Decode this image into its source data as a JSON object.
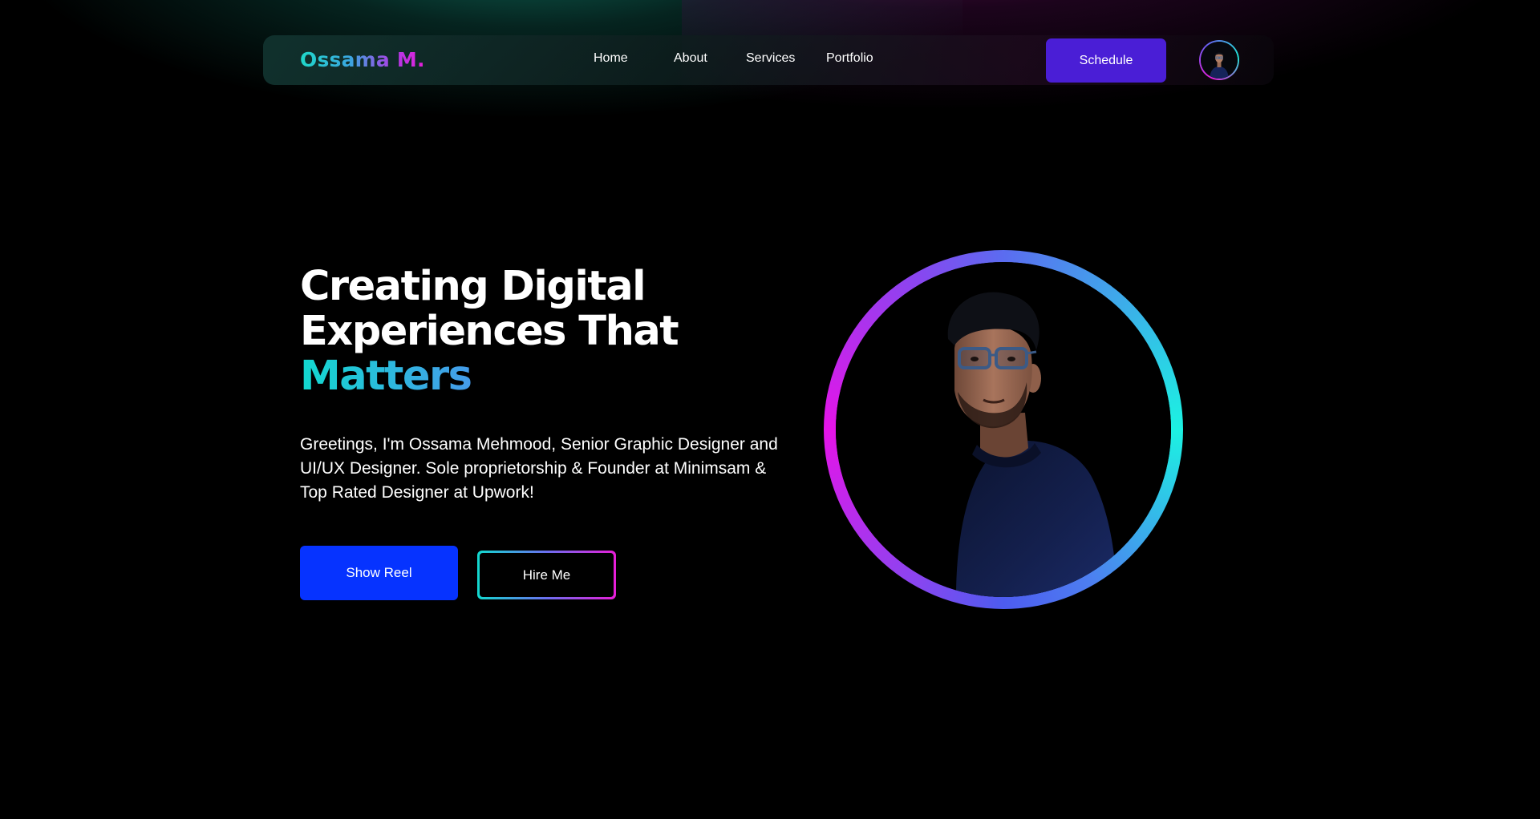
{
  "brand": {
    "logo": "Ossama M."
  },
  "nav": {
    "links": [
      "Home",
      "About",
      "Services",
      "Portfolio"
    ],
    "schedule_label": "Schedule"
  },
  "hero": {
    "title_line1": "Creating Digital",
    "title_line2": "Experiences That",
    "title_accent": "Matters",
    "description": "Greetings, I'm Ossama Mehmood, Senior Graphic Designer and UI/UX Designer. Sole proprietorship & Founder at Minimsam & Top Rated Designer at Upwork!",
    "primary_button": "Show Reel",
    "secondary_button": "Hire Me"
  },
  "icons": {
    "avatar": "profile-photo-icon",
    "portrait": "portrait-photo"
  },
  "colors": {
    "background": "#000000",
    "schedule_button": "#4a1ed6",
    "show_reel_button": "#0633ff",
    "gradient_start": "#12d9cf",
    "gradient_end": "#e81ed8"
  }
}
